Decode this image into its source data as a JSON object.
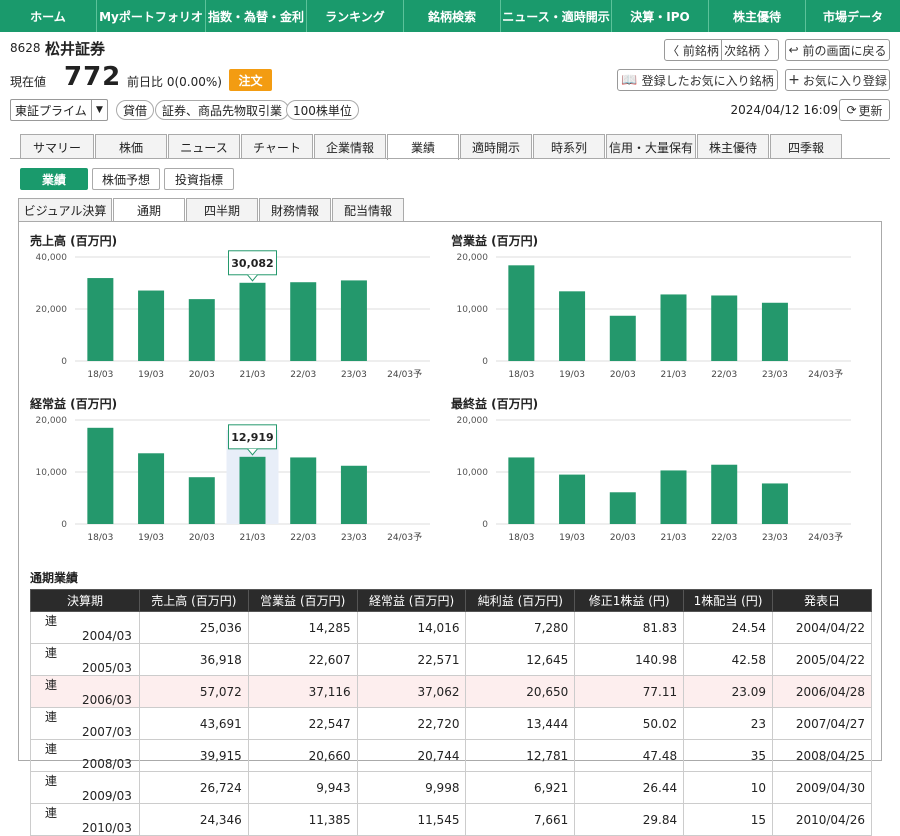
{
  "nav": [
    "ホーム",
    "Myポートフォリオ",
    "指数・為替・金利",
    "ランキング",
    "銘柄検索",
    "ニュース・適時開示",
    "決算・IPO",
    "株主優待",
    "市場データ"
  ],
  "stock": {
    "code": "8628",
    "name": "松井証券",
    "price_label": "現在値",
    "price": "772",
    "change": "前日比 0(0.00%)",
    "order": "注文"
  },
  "header_buttons": {
    "prev": "〈 前銘柄",
    "next": "次銘柄 〉",
    "back": "前の画面に戻る",
    "registered": "登録したお気に入り銘柄",
    "add_fav": "お気に入り登録",
    "refresh": "更新"
  },
  "market": {
    "selected": "東証プライム"
  },
  "tags": [
    "貸借",
    "証券、商品先物取引業",
    "100株単位"
  ],
  "datetime": "2024/04/12 16:09",
  "tabs": [
    "サマリー",
    "株価",
    "ニュース",
    "チャート",
    "企業情報",
    "業績",
    "適時開示",
    "時系列",
    "信用・大量保有",
    "株主優待",
    "四季報"
  ],
  "subbuttons": [
    "業績",
    "株価予想",
    "投資指標"
  ],
  "tabs2": [
    "ビジュアル決算",
    "通期",
    "四半期",
    "財務情報",
    "配当情報"
  ],
  "chart_data": [
    {
      "type": "bar",
      "title": "売上高 (百万円)",
      "categories": [
        "18/03",
        "19/03",
        "20/03",
        "21/03",
        "22/03",
        "23/03",
        "24/03予"
      ],
      "values": [
        31900,
        27100,
        23800,
        30082,
        30300,
        31000,
        null
      ],
      "ylim": [
        0,
        40000
      ],
      "yticks": [
        "0",
        "20,000",
        "40,000"
      ],
      "tooltip": {
        "index": 3,
        "label": "30,082"
      },
      "color": "#24986c"
    },
    {
      "type": "bar",
      "title": "営業益 (百万円)",
      "categories": [
        "18/03",
        "19/03",
        "20/03",
        "21/03",
        "22/03",
        "23/03",
        "24/03予"
      ],
      "values": [
        18400,
        13400,
        8700,
        12800,
        12600,
        11200,
        null
      ],
      "ylim": [
        0,
        20000
      ],
      "yticks": [
        "0",
        "10,000",
        "20,000"
      ],
      "color": "#24986c"
    },
    {
      "type": "bar",
      "title": "経常益 (百万円)",
      "categories": [
        "18/03",
        "19/03",
        "20/03",
        "21/03",
        "22/03",
        "23/03",
        "24/03予"
      ],
      "values": [
        18500,
        13600,
        9000,
        12919,
        12800,
        11200,
        null
      ],
      "ylim": [
        0,
        20000
      ],
      "yticks": [
        "0",
        "10,000",
        "20,000"
      ],
      "tooltip": {
        "index": 3,
        "label": "12,919"
      },
      "color": "#24986c"
    },
    {
      "type": "bar",
      "title": "最終益 (百万円)",
      "categories": [
        "18/03",
        "19/03",
        "20/03",
        "21/03",
        "22/03",
        "23/03",
        "24/03予"
      ],
      "values": [
        12800,
        9500,
        6100,
        10300,
        11400,
        7800,
        null
      ],
      "ylim": [
        0,
        20000
      ],
      "yticks": [
        "0",
        "10,000",
        "20,000"
      ],
      "color": "#24986c"
    }
  ],
  "table": {
    "title": "通期業績",
    "headers": [
      "決算期",
      "売上高 (百万円)",
      "営業益 (百万円)",
      "経常益 (百万円)",
      "純利益 (百万円)",
      "修正1株益 (円)",
      "1株配当 (円)",
      "発表日"
    ],
    "rows": [
      [
        "連",
        "2004/03",
        "25,036",
        "14,285",
        "14,016",
        "7,280",
        "81.83",
        "24.54",
        "2004/04/22"
      ],
      [
        "連",
        "2005/03",
        "36,918",
        "22,607",
        "22,571",
        "12,645",
        "140.98",
        "42.58",
        "2005/04/22"
      ],
      [
        "連",
        "2006/03",
        "57,072",
        "37,116",
        "37,062",
        "20,650",
        "77.11",
        "23.09",
        "2006/04/28"
      ],
      [
        "連",
        "2007/03",
        "43,691",
        "22,547",
        "22,720",
        "13,444",
        "50.02",
        "23",
        "2007/04/27"
      ],
      [
        "連",
        "2008/03",
        "39,915",
        "20,660",
        "20,744",
        "12,781",
        "47.48",
        "35",
        "2008/04/25"
      ],
      [
        "連",
        "2009/03",
        "26,724",
        "9,943",
        "9,998",
        "6,921",
        "26.44",
        "10",
        "2009/04/30"
      ],
      [
        "連",
        "2010/03",
        "24,346",
        "11,385",
        "11,545",
        "7,661",
        "29.84",
        "15",
        "2010/04/26"
      ]
    ]
  }
}
